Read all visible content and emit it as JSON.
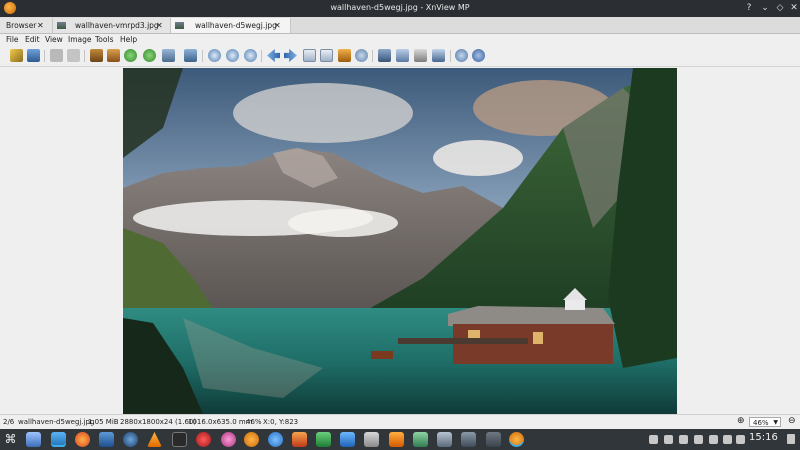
{
  "window": {
    "title": "wallhaven-d5wegj.jpg - XnView MP"
  },
  "tabs": [
    {
      "label": "Browser"
    },
    {
      "label": "wallhaven-vmrpd3.jpg"
    },
    {
      "label": "wallhaven-d5wegj.jpg"
    }
  ],
  "menu": [
    "File",
    "Edit",
    "View",
    "Image",
    "Tools",
    "Help"
  ],
  "toolbar_icons": [
    "browse-icon",
    "save-icon",
    "undo-icon",
    "redo-icon",
    "crop-icon",
    "resize-icon",
    "rotate-left-icon",
    "rotate-right-icon",
    "adjust-icon",
    "filter-icon",
    "zoom-in-icon",
    "zoom-fit-icon",
    "zoom-out-icon",
    "previous-icon",
    "next-icon",
    "first-icon",
    "last-icon",
    "slideshow-icon",
    "copy-icon",
    "compare-icon",
    "edit-icon",
    "print-icon",
    "screenshot-icon",
    "settings-icon",
    "info-icon"
  ],
  "status": {
    "position": "2/6",
    "filename": "wallhaven-d5wegj.jpg",
    "filesize": "1.05 MiB",
    "dimensions": "2880x1800x24 (1.60)",
    "print_size": "1016.0x635.0 mm",
    "zoom_pct": "46%",
    "coords": "X:0, Y:823",
    "zoom_value": "46%"
  },
  "taskbar": {
    "time": "15:16",
    "apps": [
      "app-launcher",
      "system-settings",
      "file-manager",
      "firefox",
      "virtualbox",
      "steam",
      "vlc",
      "terminal",
      "game",
      "media",
      "xnview",
      "browser",
      "music",
      "spreadsheet",
      "document",
      "image-viewer",
      "monitor",
      "screen",
      "video",
      "xnview-active"
    ],
    "tray": [
      "tray-icon-1",
      "tray-icon-2",
      "tray-icon-3",
      "tray-icon-4",
      "tray-icon-5",
      "tray-icon-6",
      "tray-icon-7"
    ]
  },
  "colors": {
    "titlebar": "#2b2f33",
    "taskbar": "#31363b",
    "accent": "#3daee9"
  }
}
